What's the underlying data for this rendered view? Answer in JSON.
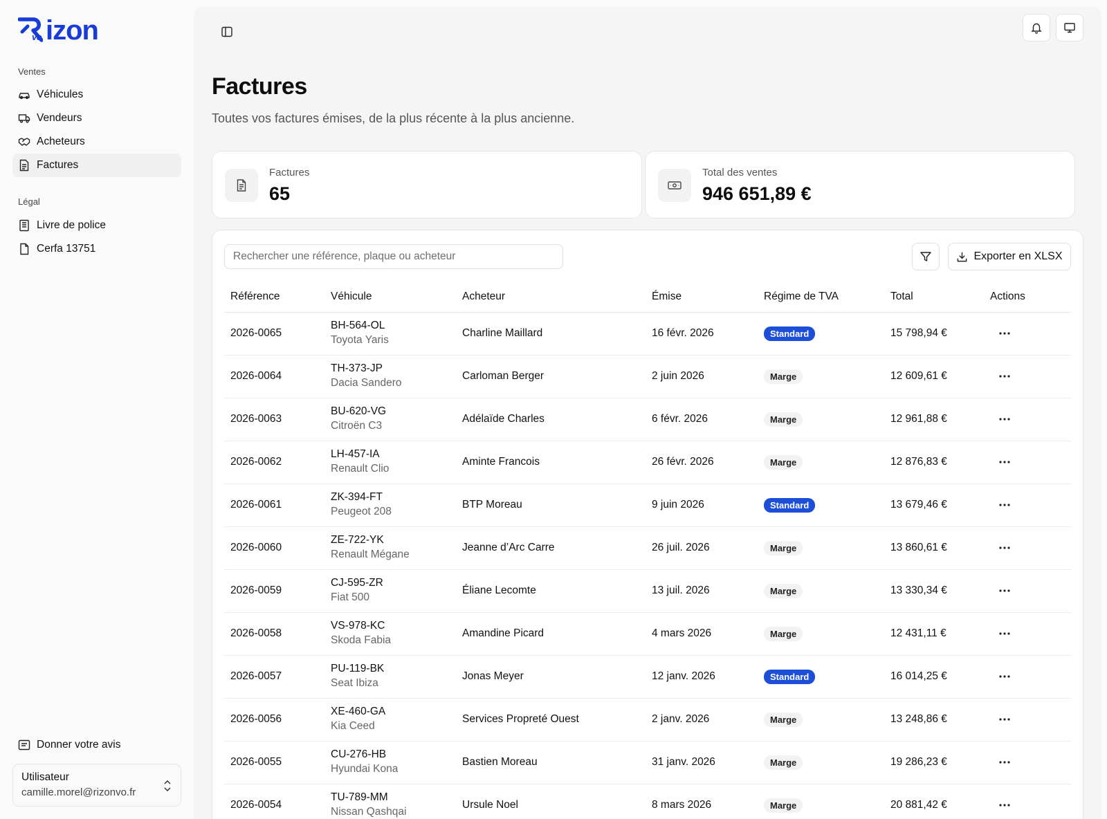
{
  "brand": {
    "vo": "vo",
    "word": "izon",
    "color": "#1a3bd6"
  },
  "sidebar": {
    "section_ventes": "Ventes",
    "ventes_items": [
      {
        "label": "Véhicules",
        "icon": "car-icon"
      },
      {
        "label": "Vendeurs",
        "icon": "truck-icon"
      },
      {
        "label": "Acheteurs",
        "icon": "handshake-icon"
      },
      {
        "label": "Factures",
        "icon": "invoice-icon",
        "active": true
      }
    ],
    "section_legal": "Légal",
    "legal_items": [
      {
        "label": "Livre de police",
        "icon": "book-icon"
      },
      {
        "label": "Cerfa 13751",
        "icon": "file-icon"
      }
    ],
    "feedback": "Donner votre avis",
    "user": {
      "name": "Utilisateur",
      "email": "camille.morel@rizonvo.fr"
    }
  },
  "page": {
    "title": "Factures",
    "subtitle": "Toutes vos factures émises, de la plus récente à la plus ancienne."
  },
  "stats": [
    {
      "label": "Factures",
      "value": "65",
      "icon": "document-icon"
    },
    {
      "label": "Total des ventes",
      "value": "946 651,89 €",
      "icon": "banknote-icon"
    }
  ],
  "toolbar": {
    "search_placeholder": "Rechercher une référence, plaque ou acheteur",
    "export_label": "Exporter en XLSX"
  },
  "table": {
    "columns": [
      "Référence",
      "Véhicule",
      "Acheteur",
      "Émise",
      "Régime de TVA",
      "Total",
      "Actions"
    ],
    "rows": [
      {
        "ref": "2026-0065",
        "plate": "BH-564-OL",
        "model": "Toyota Yaris",
        "buyer": "Charline Maillard",
        "date": "16 févr. 2026",
        "vat": "Standard",
        "total": "15 798,94 €"
      },
      {
        "ref": "2026-0064",
        "plate": "TH-373-JP",
        "model": "Dacia Sandero",
        "buyer": "Carloman Berger",
        "date": "2 juin 2026",
        "vat": "Marge",
        "total": "12 609,61 €"
      },
      {
        "ref": "2026-0063",
        "plate": "BU-620-VG",
        "model": "Citroën C3",
        "buyer": "Adélaïde Charles",
        "date": "6 févr. 2026",
        "vat": "Marge",
        "total": "12 961,88 €"
      },
      {
        "ref": "2026-0062",
        "plate": "LH-457-IA",
        "model": "Renault Clio",
        "buyer": "Aminte Francois",
        "date": "26 févr. 2026",
        "vat": "Marge",
        "total": "12 876,83 €"
      },
      {
        "ref": "2026-0061",
        "plate": "ZK-394-FT",
        "model": "Peugeot 208",
        "buyer": "BTP Moreau",
        "date": "9 juin 2026",
        "vat": "Standard",
        "total": "13 679,46 €"
      },
      {
        "ref": "2026-0060",
        "plate": "ZE-722-YK",
        "model": "Renault Mégane",
        "buyer": "Jeanne d’Arc Carre",
        "date": "26 juil. 2026",
        "vat": "Marge",
        "total": "13 860,61 €"
      },
      {
        "ref": "2026-0059",
        "plate": "CJ-595-ZR",
        "model": "Fiat 500",
        "buyer": "Éliane Lecomte",
        "date": "13 juil. 2026",
        "vat": "Marge",
        "total": "13 330,34 €"
      },
      {
        "ref": "2026-0058",
        "plate": "VS-978-KC",
        "model": "Skoda Fabia",
        "buyer": "Amandine Picard",
        "date": "4 mars 2026",
        "vat": "Marge",
        "total": "12 431,11 €"
      },
      {
        "ref": "2026-0057",
        "plate": "PU-119-BK",
        "model": "Seat Ibiza",
        "buyer": "Jonas Meyer",
        "date": "12 janv. 2026",
        "vat": "Standard",
        "total": "16 014,25 €"
      },
      {
        "ref": "2026-0056",
        "plate": "XE-460-GA",
        "model": "Kia Ceed",
        "buyer": "Services Propreté Ouest",
        "date": "2 janv. 2026",
        "vat": "Marge",
        "total": "13 248,86 €"
      },
      {
        "ref": "2026-0055",
        "plate": "CU-276-HB",
        "model": "Hyundai Kona",
        "buyer": "Bastien Moreau",
        "date": "31 janv. 2026",
        "vat": "Marge",
        "total": "19 286,23 €"
      },
      {
        "ref": "2026-0054",
        "plate": "TU-789-MM",
        "model": "Nissan Qashqai",
        "buyer": "Ursule Noel",
        "date": "8 mars 2026",
        "vat": "Marge",
        "total": "20 881,42 €"
      }
    ]
  }
}
